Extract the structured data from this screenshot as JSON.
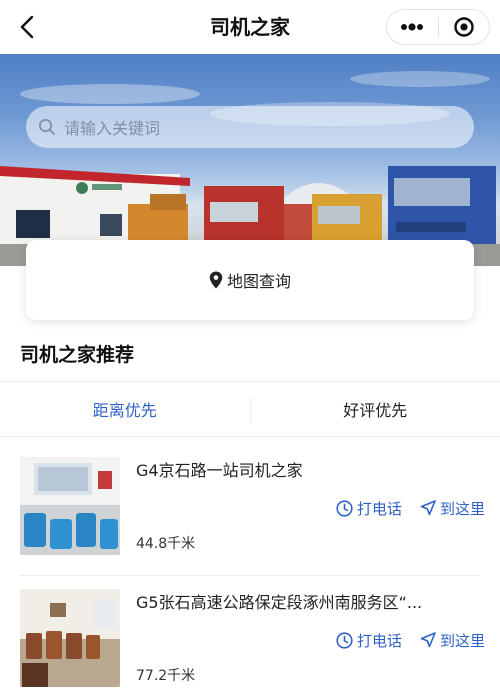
{
  "navbar": {
    "title": "司机之家",
    "back_icon": "chevron-left-icon",
    "more_icon": "more-dots-icon",
    "close_icon": "target-circle-icon"
  },
  "search": {
    "placeholder": "请输入关键词",
    "icon": "search-icon"
  },
  "map_query": {
    "label": "地图查询",
    "icon": "location-pin-icon"
  },
  "section": {
    "title": "司机之家推荐"
  },
  "tabs": [
    {
      "label": "距离优先",
      "active": true
    },
    {
      "label": "好评优先",
      "active": false
    }
  ],
  "items": [
    {
      "name": "G4京石路一站司机之家",
      "call_label": "打电话",
      "nav_label": "到这里",
      "distance": "44.8千米"
    },
    {
      "name": "G5张石高速公路保定段涿州南服务区“...",
      "call_label": "打电话",
      "nav_label": "到这里",
      "distance": "77.2千米"
    }
  ],
  "colors": {
    "accent": "#2f62c9",
    "text": "#222222",
    "divider": "#eeeeee"
  }
}
